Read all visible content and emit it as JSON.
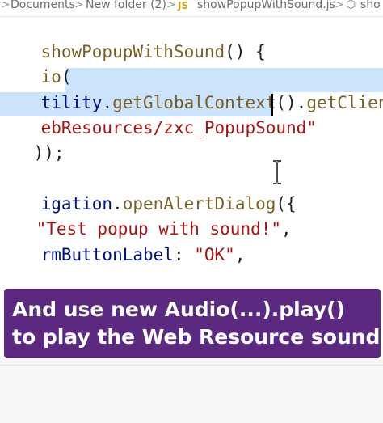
{
  "breadcrumb": {
    "item1": "Documents",
    "item2": "New folder (2)",
    "file_badge": "JS",
    "file": "showPopupWithSound.js",
    "item_last": "sho",
    "separator": ">"
  },
  "code": {
    "l1_name": "showPopupWithSound",
    "l1_rest": "() {",
    "l2_a": "io",
    "l2_b": "(",
    "l3_a": "tility",
    "l3_b": ".",
    "l3_c": "getGlobalContext",
    "l3_d": "().",
    "l3_e": "getClientUrl",
    "l4": "ebResources/zxc_PopupSound\"",
    "l5_a": "))",
    "l5_b": ";",
    "l6_a": "igation",
    "l6_b": ".",
    "l6_c": "openAlertDialog",
    "l6_d": "({",
    "l7": "\"Test popup with sound!\"",
    "l7_comma": ",",
    "l8_a": "rmButtonLabel",
    "l8_b": ": ",
    "l8_c": "\"OK\"",
    "l8_d": ","
  },
  "caption": {
    "line1": "And use new Audio(...).play()",
    "line2": "to play the Web Resource sound."
  },
  "colors": {
    "caption_bg": "#5b2a80",
    "selection": "#cce4fb",
    "string": "#a31515",
    "function": "#795e26",
    "property": "#001080"
  }
}
